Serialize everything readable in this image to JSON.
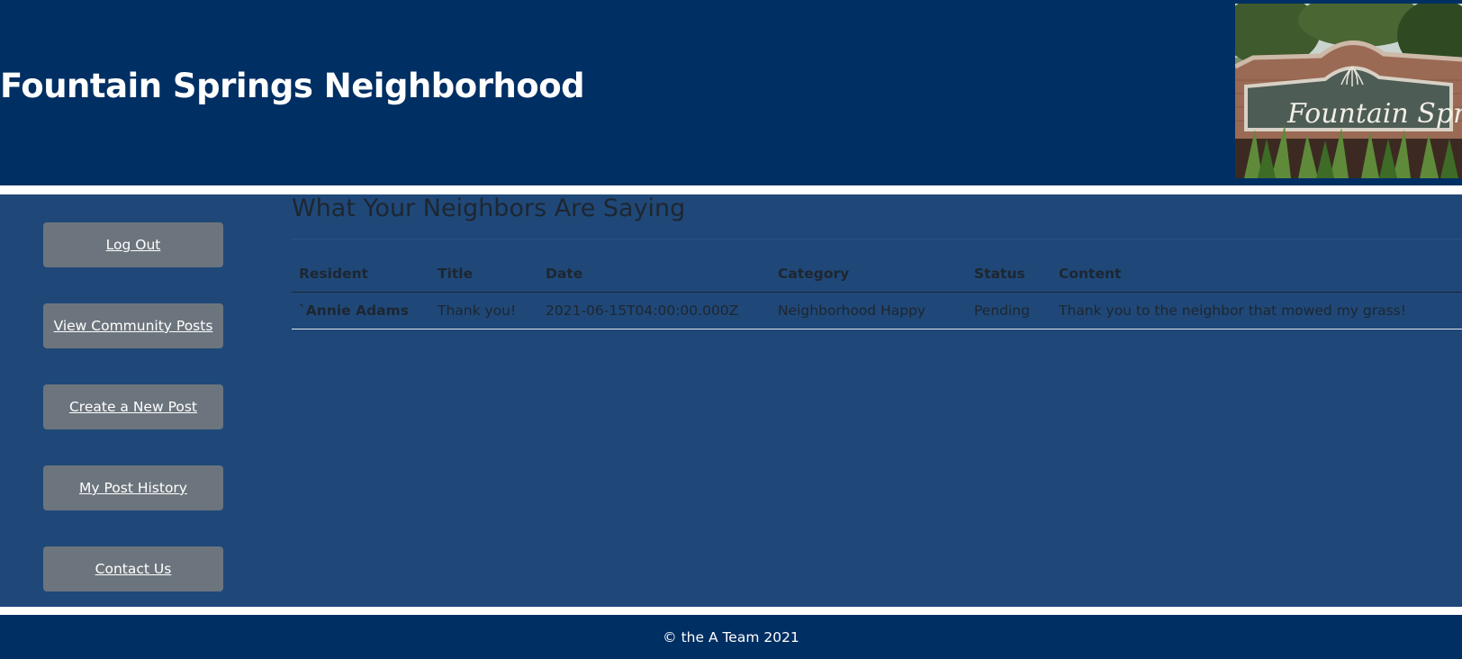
{
  "header": {
    "title": "Fountain Springs Neighborhood",
    "photo_icon": "entrance-sign-photo",
    "photo_sign_text": "Fountain Springs"
  },
  "nav": {
    "logout_label": "Log Out",
    "view_posts_label": "View Community Posts",
    "create_post_label": "Create a New Post",
    "history_label": "My Post History",
    "contact_label": "Contact Us"
  },
  "main": {
    "section_title": "What Your Neighbors Are Saying",
    "columns": [
      "Resident",
      "Title",
      "Date",
      "Category",
      "Status",
      "Content"
    ],
    "rows": [
      {
        "resident": "`Annie Adams",
        "title": "Thank you!",
        "date": "2021-06-15T04:00:00.000Z",
        "category": "Neighborhood Happy",
        "status": "Pending",
        "content": "Thank you to the neighbor that mowed my grass!"
      }
    ]
  },
  "footer": {
    "text": "© the A Team 2021"
  },
  "colors": {
    "header_bg": "#002f63",
    "main_bg": "#1f4878",
    "button_bg": "#6c757d",
    "text_dark": "#1e2630"
  }
}
